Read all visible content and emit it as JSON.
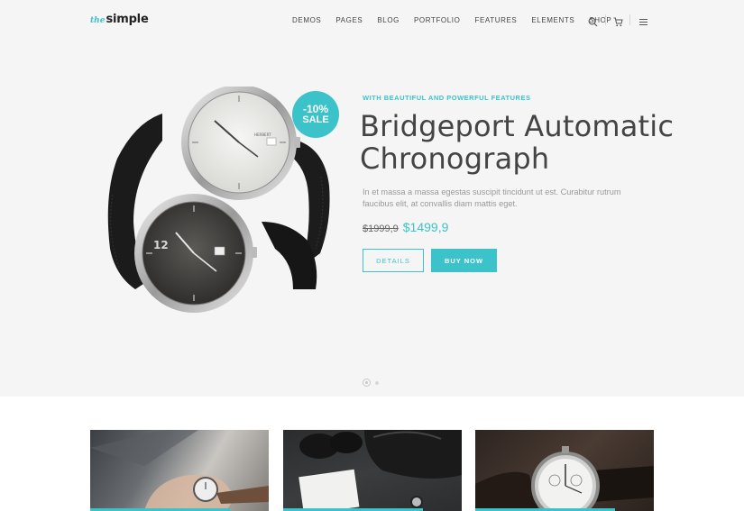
{
  "brand": {
    "logo_the": "the",
    "logo_simple": "simple"
  },
  "nav": {
    "items": [
      "DEMOS",
      "PAGES",
      "BLOG",
      "PORTFOLIO",
      "FEATURES",
      "ELEMENTS",
      "SHOP"
    ],
    "icons": [
      "search-icon",
      "cart-icon",
      "menu-icon"
    ]
  },
  "hero": {
    "badge_pct": "-10%",
    "badge_label": "SALE",
    "kicker": "WITH BEAUTIFUL AND POWERFUL FEATURES",
    "title_line1": "Bridgeport Automatic",
    "title_line2": "Chronograph",
    "description": "In et massa a massa egestas suscipit tincidunt ut est. Curabitur rutrum faucibus elit, at convallis diam mattis eget.",
    "price_old": "$1999,9",
    "price_new": "$1499,9",
    "details_label": "DETAILS",
    "buy_label": "BUY NOW",
    "watch_brand": "HERBERT"
  },
  "colors": {
    "accent": "#3cc3c9",
    "background": "#f5f5f5",
    "text": "#444444"
  },
  "cards": [
    {
      "image": "wrist-watch-photo"
    },
    {
      "image": "bag-shoes-notebook-photo"
    },
    {
      "image": "watch-closeup-photo"
    }
  ]
}
